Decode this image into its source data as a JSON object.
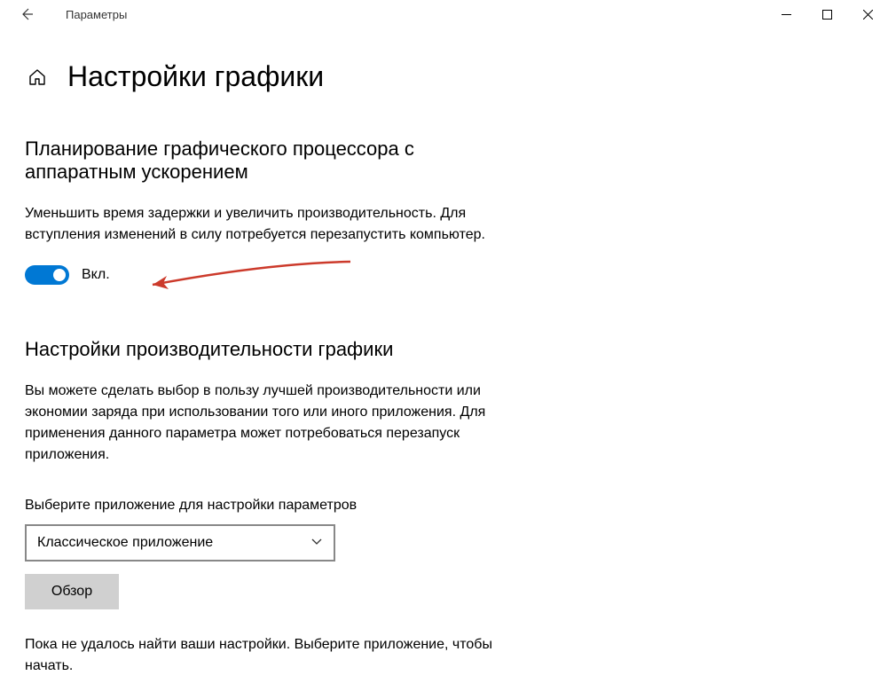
{
  "window": {
    "title": "Параметры"
  },
  "page": {
    "title": "Настройки графики"
  },
  "section1": {
    "heading": "Планирование графического процессора с аппаратным ускорением",
    "description": "Уменьшить время задержки и увеличить производительность. Для вступления изменений в силу потребуется перезапустить компьютер.",
    "toggle_label": "Вкл."
  },
  "section2": {
    "heading": "Настройки производительности графики",
    "description": "Вы можете сделать выбор в пользу лучшей производительности или экономии заряда при использовании того или иного приложения. Для применения данного параметра может потребоваться перезапуск приложения.",
    "select_label": "Выберите приложение для настройки параметров",
    "dropdown_value": "Классическое приложение",
    "browse_button": "Обзор",
    "empty_state": "Пока не удалось найти ваши настройки. Выберите приложение, чтобы начать."
  }
}
